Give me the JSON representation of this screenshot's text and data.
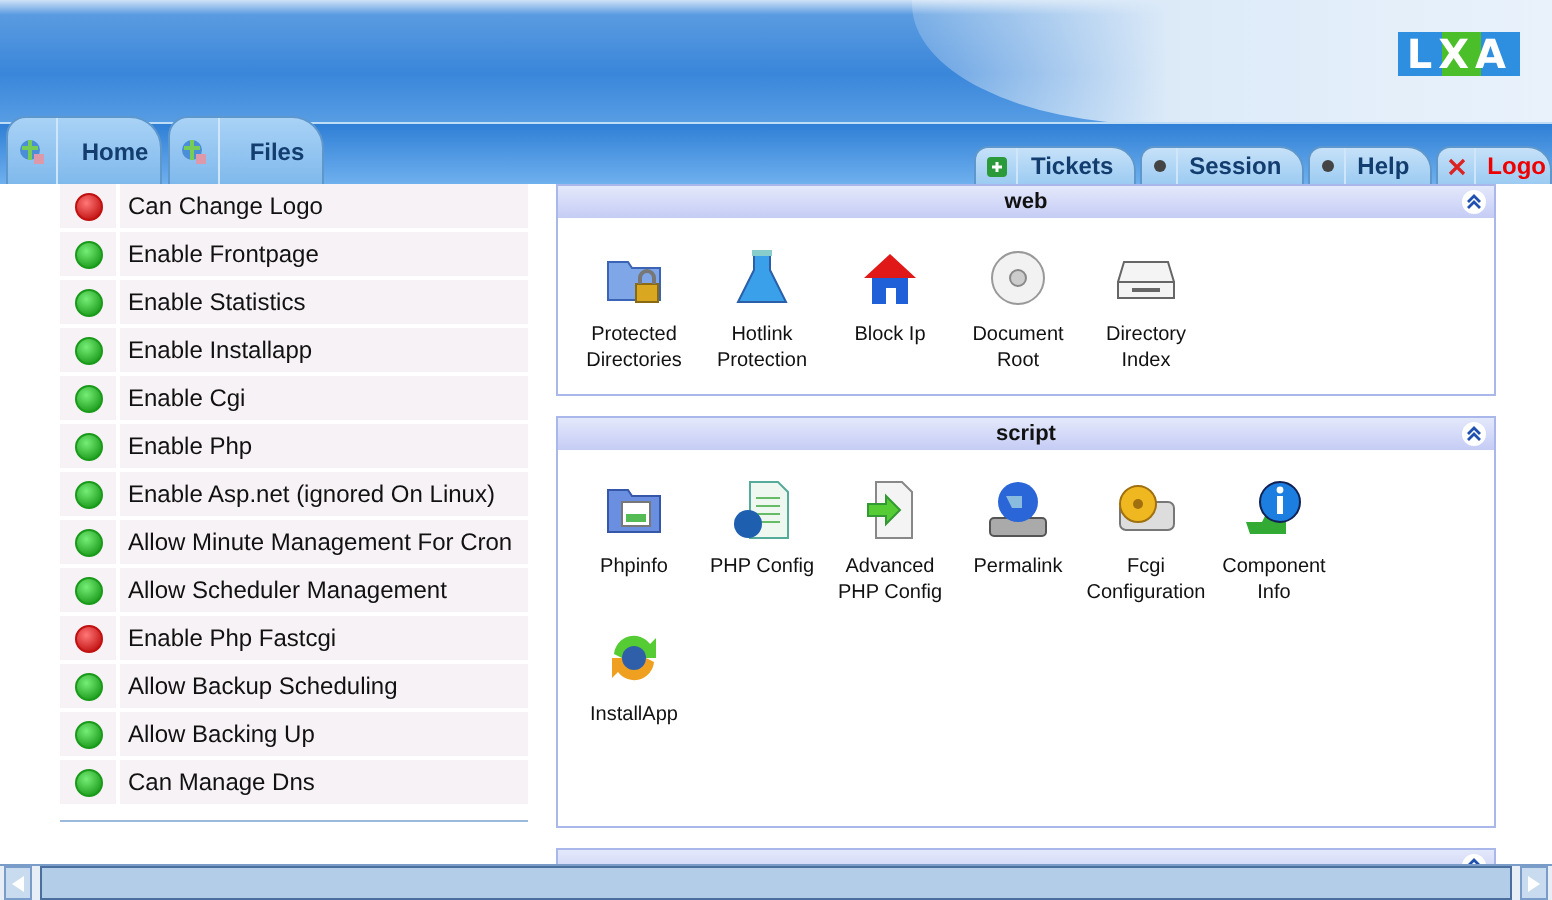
{
  "header": {
    "logo": "LXA"
  },
  "main_tabs": [
    {
      "label": "Home"
    },
    {
      "label": "Files"
    }
  ],
  "top_tabs": [
    {
      "label": "Tickets",
      "kind": "link"
    },
    {
      "label": "Session",
      "kind": "link"
    },
    {
      "label": "Help",
      "kind": "link"
    },
    {
      "label": "Logo",
      "kind": "logout"
    }
  ],
  "permissions": [
    {
      "label": "Can Change Logo",
      "on": false
    },
    {
      "label": "Enable Frontpage",
      "on": true
    },
    {
      "label": "Enable Statistics",
      "on": true
    },
    {
      "label": "Enable Installapp",
      "on": true
    },
    {
      "label": "Enable Cgi",
      "on": true
    },
    {
      "label": "Enable Php",
      "on": true
    },
    {
      "label": "Enable Asp.net (ignored On Linux)",
      "on": true
    },
    {
      "label": "Allow Minute Management For Cron",
      "on": true
    },
    {
      "label": "Allow Scheduler Management",
      "on": true
    },
    {
      "label": "Enable Php Fastcgi",
      "on": false
    },
    {
      "label": "Allow Backup Scheduling",
      "on": true
    },
    {
      "label": "Allow Backing Up",
      "on": true
    },
    {
      "label": "Can Manage Dns",
      "on": true
    }
  ],
  "panels": [
    {
      "title": "web",
      "items": [
        "Protected Directories",
        "Hotlink Protection",
        "Block Ip",
        "Document Root",
        "Directory Index"
      ]
    },
    {
      "title": "script",
      "items": [
        "Phpinfo",
        "PHP Config",
        "Advanced PHP Config",
        "Permalink",
        "Fcgi Configuration",
        "Component Info",
        "InstallApp"
      ]
    }
  ]
}
